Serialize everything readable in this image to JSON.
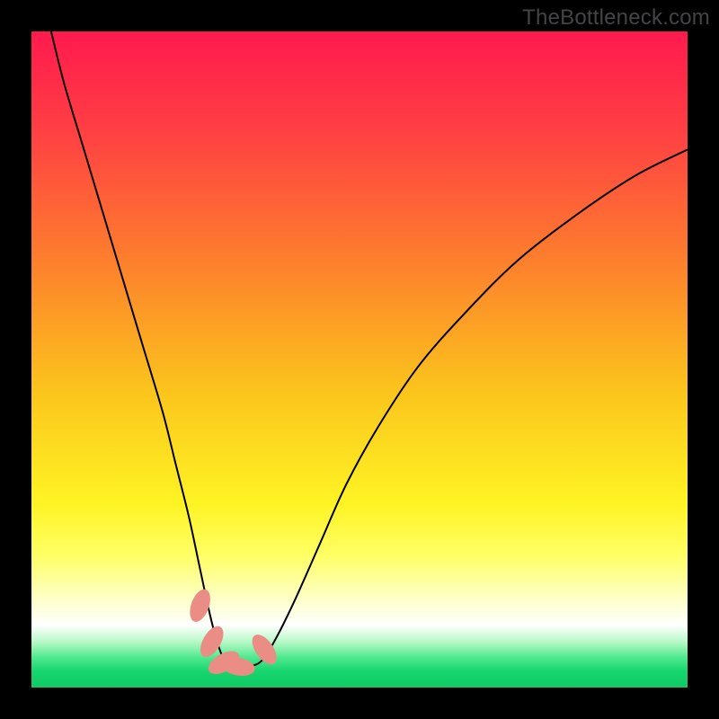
{
  "watermark": "TheBottleneck.com",
  "chart_data": {
    "type": "line",
    "title": "",
    "xlabel": "",
    "ylabel": "",
    "xlim": [
      0,
      100
    ],
    "ylim": [
      0,
      100
    ],
    "gradient_stops": [
      {
        "offset": 0.0,
        "color": "#ff1a4e"
      },
      {
        "offset": 0.15,
        "color": "#ff3f43"
      },
      {
        "offset": 0.35,
        "color": "#fd7f2d"
      },
      {
        "offset": 0.55,
        "color": "#fbc51c"
      },
      {
        "offset": 0.72,
        "color": "#fef424"
      },
      {
        "offset": 0.8,
        "color": "#ffff66"
      },
      {
        "offset": 0.86,
        "color": "#feffbf"
      },
      {
        "offset": 0.905,
        "color": "#ffffff"
      },
      {
        "offset": 0.93,
        "color": "#b8f9c7"
      },
      {
        "offset": 0.955,
        "color": "#4de88d"
      },
      {
        "offset": 0.975,
        "color": "#16d66e"
      },
      {
        "offset": 1.0,
        "color": "#10c964"
      }
    ],
    "series": [
      {
        "name": "bottleneck-curve",
        "stroke": "#000000",
        "x": [
          3,
          5,
          8,
          11,
          14,
          17,
          20,
          22,
          24,
          25.5,
          27,
          28,
          29,
          30,
          31,
          33,
          35,
          37,
          40,
          44,
          48,
          53,
          59,
          66,
          74,
          83,
          92,
          100
        ],
        "values": [
          100,
          92,
          82,
          72,
          62,
          52,
          42,
          34,
          26,
          19,
          12,
          8,
          5,
          3.5,
          3.2,
          3.2,
          4,
          7,
          13,
          22,
          31,
          40,
          49,
          57,
          65,
          72,
          78,
          82
        ]
      }
    ],
    "markers": {
      "name": "highlight-nodes",
      "color": "#e98d85",
      "points": [
        {
          "x": 25.7,
          "y": 12.5,
          "rot": -70
        },
        {
          "x": 27.5,
          "y": 7.0,
          "rot": -60
        },
        {
          "x": 29.3,
          "y": 3.8,
          "rot": -30
        },
        {
          "x": 31.5,
          "y": 3.2,
          "rot": 10
        },
        {
          "x": 35.5,
          "y": 5.8,
          "rot": 55
        }
      ],
      "rx": 2.6,
      "ry": 1.35
    }
  }
}
